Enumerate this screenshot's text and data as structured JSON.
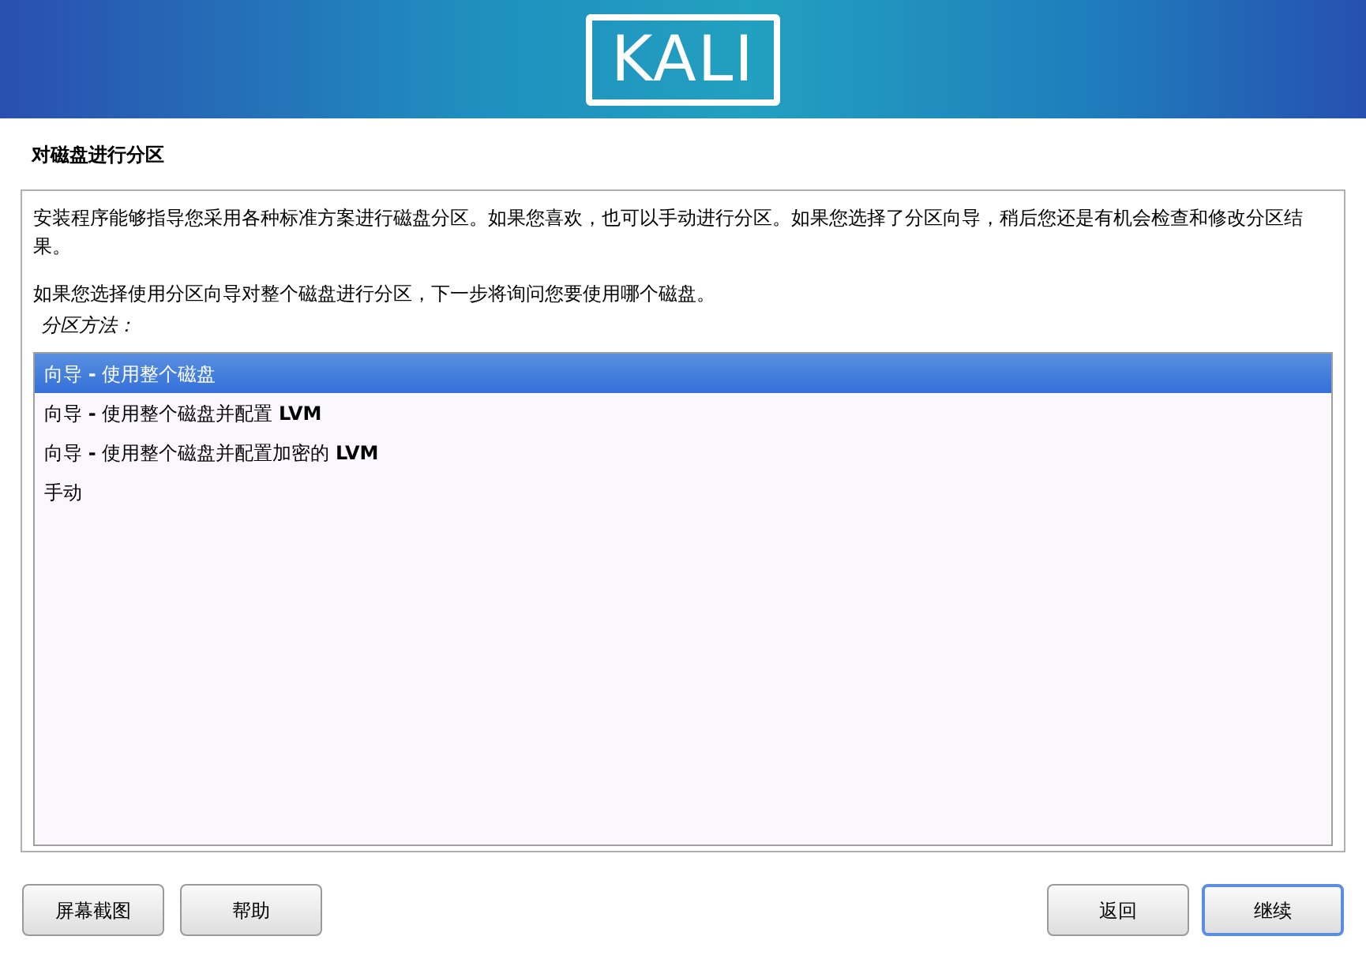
{
  "header": {
    "logo": "KALI"
  },
  "title": "对磁盘进行分区",
  "paragraphs": [
    "安装程序能够指导您采用各种标准方案进行磁盘分区。如果您喜欢，也可以手动进行分区。如果您选择了分区向导，稍后您还是有机会检查和修改分区结果。",
    "如果您选择使用分区向导对整个磁盘进行分区，下一步将询问您要使用哪个磁盘。"
  ],
  "list_label": "分区方法：",
  "options": [
    {
      "label": "向导 **-** 使用整个磁盘",
      "selected": true
    },
    {
      "label": "向导 **-** 使用整个磁盘并配置 **LVM**",
      "selected": false
    },
    {
      "label": "向导 **-** 使用整个磁盘并配置加密的 **LVM**",
      "selected": false
    },
    {
      "label": "手动",
      "selected": false
    }
  ],
  "buttons_left": [
    "屏幕截图",
    "帮助"
  ],
  "buttons_right": [
    {
      "label": "返回",
      "default": false
    },
    {
      "label": "继续",
      "default": true
    }
  ]
}
